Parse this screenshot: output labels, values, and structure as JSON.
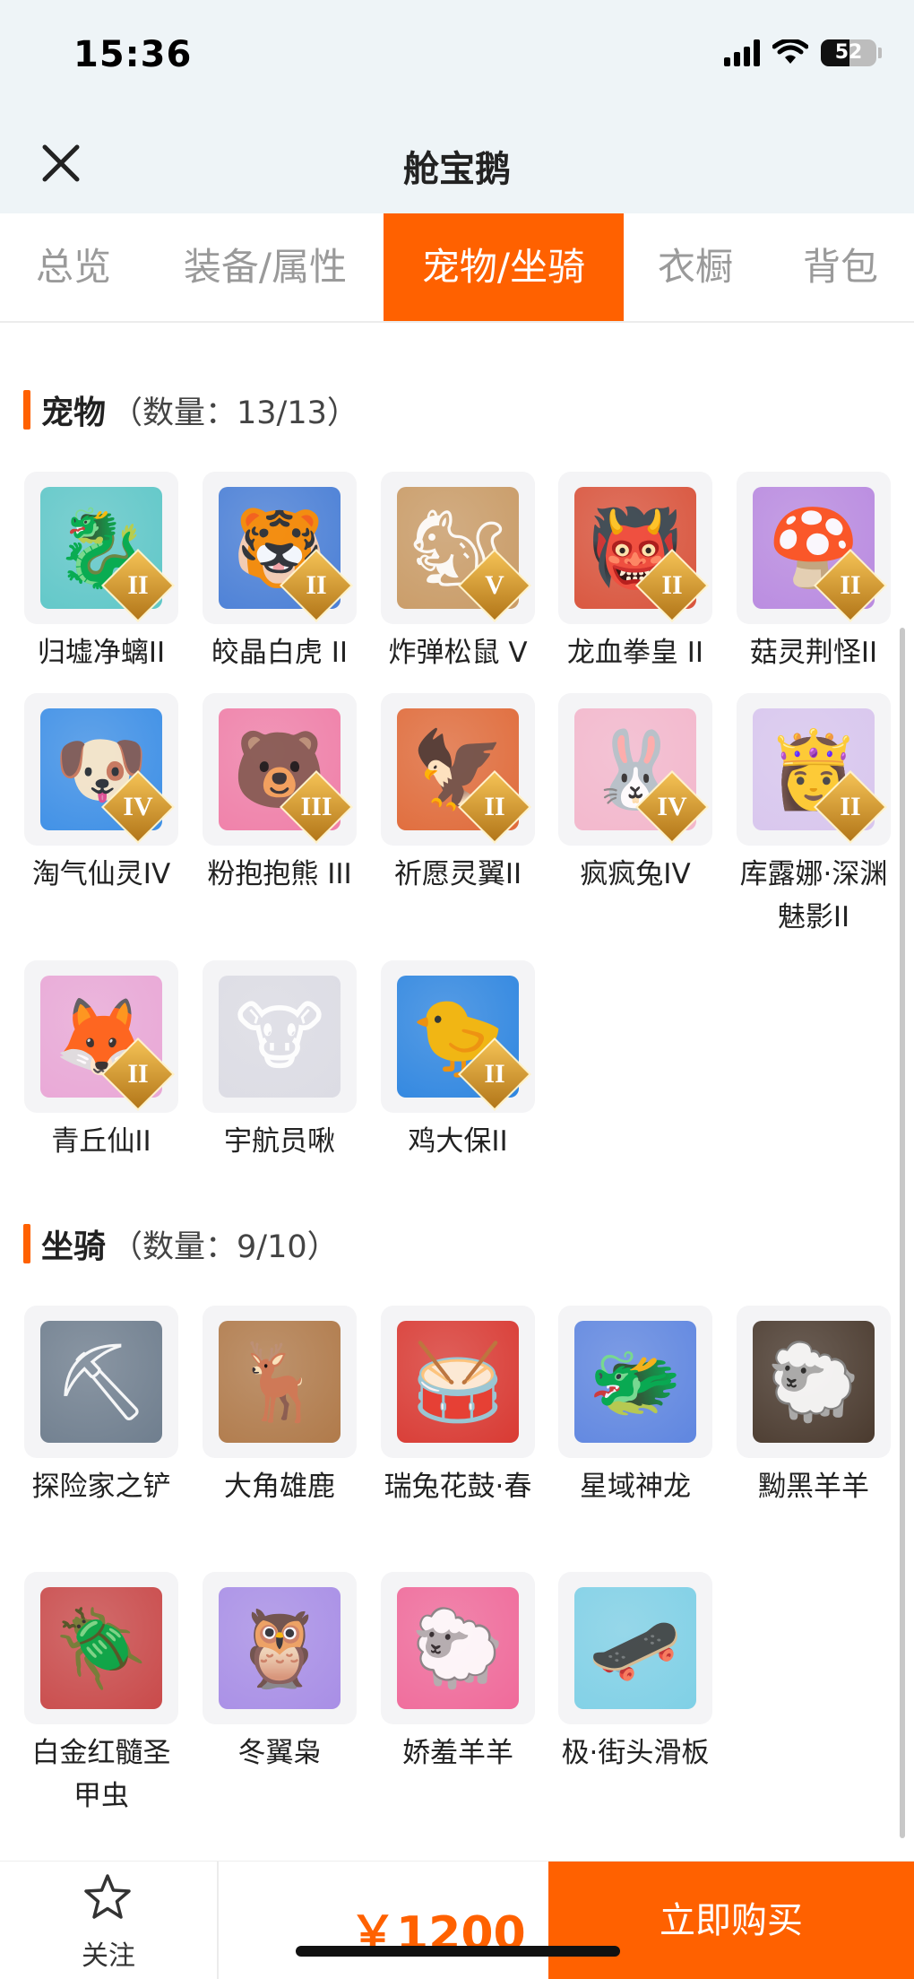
{
  "status": {
    "time": "15:36",
    "battery": "52",
    "battery_level": 0.52
  },
  "header": {
    "title": "舱宝鹅"
  },
  "tabs": [
    {
      "label": "总览",
      "active": false
    },
    {
      "label": "装备/属性",
      "active": false
    },
    {
      "label": "宠物/坐骑",
      "active": true
    },
    {
      "label": "衣橱",
      "active": false
    },
    {
      "label": "背包",
      "active": false
    }
  ],
  "pets": {
    "title": "宠物",
    "count": "（数量：13/13）",
    "items": [
      {
        "name": "归墟净螭II",
        "badge": "II",
        "color": "#5fc7c8",
        "glyph": "🐉"
      },
      {
        "name": "皎晶白虎 II",
        "badge": "II",
        "color": "#4a7fd6",
        "glyph": "🐯"
      },
      {
        "name": "炸弹松鼠 V",
        "badge": "V",
        "color": "#c99b66",
        "glyph": "🐿"
      },
      {
        "name": "龙血拳皇 II",
        "badge": "II",
        "color": "#d9543c",
        "glyph": "👹"
      },
      {
        "name": "菇灵荆怪II",
        "badge": "II",
        "color": "#b98ae0",
        "glyph": "🍄"
      },
      {
        "name": "淘气仙灵IV",
        "badge": "IV",
        "color": "#3d8fe6",
        "glyph": "🐶"
      },
      {
        "name": "粉抱抱熊 III",
        "badge": "III",
        "color": "#f07fa8",
        "glyph": "🐻"
      },
      {
        "name": "祈愿灵翼II",
        "badge": "II",
        "color": "#e06b3a",
        "glyph": "🦅"
      },
      {
        "name": "疯疯兔IV",
        "badge": "IV",
        "color": "#f3b7cc",
        "glyph": "🐰"
      },
      {
        "name": "库露娜·深渊魅影II",
        "badge": "II",
        "color": "#d8c6ee",
        "glyph": "👸"
      },
      {
        "name": "青丘仙II",
        "badge": "II",
        "color": "#e9a7d6",
        "glyph": "🦊"
      },
      {
        "name": "宇航员啾",
        "badge": "",
        "color": "#dcdce4",
        "glyph": "🐮"
      },
      {
        "name": "鸡大保II",
        "badge": "II",
        "color": "#2f86e0",
        "glyph": "🐤"
      }
    ]
  },
  "mounts": {
    "title": "坐骑",
    "count": "（数量：9/10）",
    "items": [
      {
        "name": "探险家之铲",
        "color": "#6f7e8e",
        "glyph": "⛏"
      },
      {
        "name": "大角雄鹿",
        "color": "#b07a4a",
        "glyph": "🦌"
      },
      {
        "name": "瑞兔花鼓·春",
        "color": "#d93a33",
        "glyph": "🥁"
      },
      {
        "name": "星域神龙",
        "color": "#5f86e0",
        "glyph": "🐲"
      },
      {
        "name": "黝黑羊羊",
        "color": "#4a3a2e",
        "glyph": "🐑"
      },
      {
        "name": "白金红髓圣甲虫",
        "color": "#c94a4a",
        "glyph": "🪲"
      },
      {
        "name": "冬翼枭",
        "color": "#a88ee6",
        "glyph": "🦉"
      },
      {
        "name": "娇羞羊羊",
        "color": "#f06a9a",
        "glyph": "🐑"
      },
      {
        "name": "极·街头滑板",
        "color": "#7fd0e6",
        "glyph": "🛹"
      }
    ]
  },
  "bottom": {
    "follow_label": "关注",
    "price": "￥1200",
    "buy_label": "立即购买"
  },
  "colors": {
    "accent": "#ff6100"
  }
}
